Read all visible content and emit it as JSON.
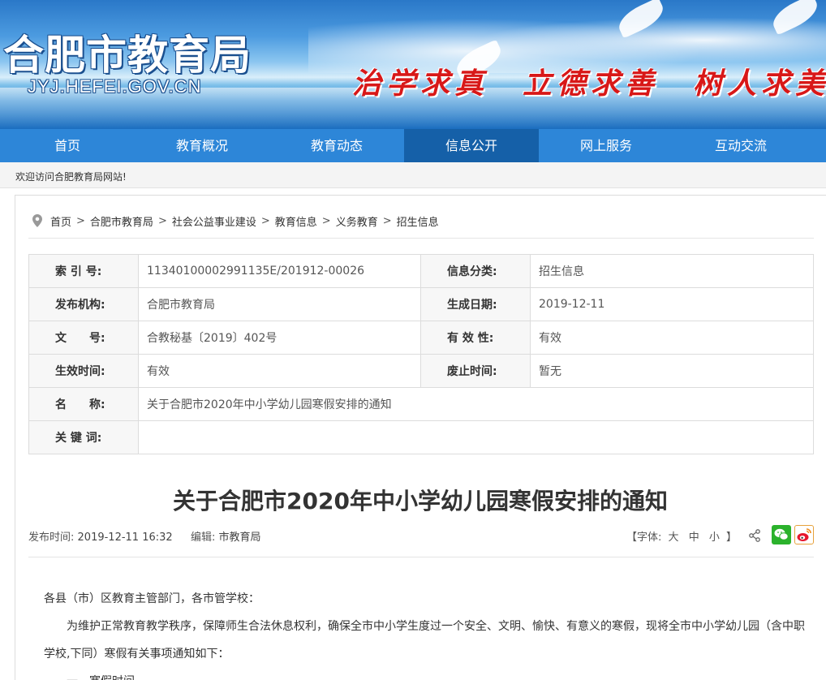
{
  "header": {
    "site_title": "合肥市教育局",
    "site_domain": "JYJ.HEFEI.GOV.CN",
    "slogan": "治学求真　立德求善　树人求美"
  },
  "nav": {
    "items": [
      {
        "label": "首页"
      },
      {
        "label": "教育概况"
      },
      {
        "label": "教育动态"
      },
      {
        "label": "信息公开"
      },
      {
        "label": "网上服务"
      },
      {
        "label": "互动交流"
      }
    ],
    "active": "信息公开"
  },
  "welcome": "欢迎访问合肥教育局网站!",
  "breadcrumb": [
    "首页",
    "合肥市教育局",
    "社会公益事业建设",
    "教育信息",
    "义务教育",
    "招生信息"
  ],
  "breadcrumb_sep": ">",
  "info": {
    "index_label": "索 引 号:",
    "index_value": "11340100002991135E/201912-00026",
    "category_label": "信息分类:",
    "category_value": "招生信息",
    "publisher_label": "发布机构:",
    "publisher_value": "合肥市教育局",
    "date_label": "生成日期:",
    "date_value": "2019-12-11",
    "doc_no_label": "文　　号:",
    "doc_no_value": "合教秘基〔2019〕402号",
    "validity_label": "有 效 性:",
    "validity_value": "有效",
    "effective_label": "生效时间:",
    "effective_value": "有效",
    "expiry_label": "废止时间:",
    "expiry_value": "暂无",
    "name_label": "名　　称:",
    "name_value": "关于合肥市2020年中小学幼儿园寒假安排的通知",
    "keywords_label": "关 键 词:",
    "keywords_value": ""
  },
  "article": {
    "title": "关于合肥市2020年中小学幼儿园寒假安排的通知",
    "publish_label": "发布时间:",
    "publish_time": "2019-12-11 16:32",
    "editor_label": "编辑:",
    "editor": "市教育局",
    "font_label_open": "【字体:",
    "font_large": "大",
    "font_medium": "中",
    "font_small": "小",
    "font_label_close": "】",
    "greeting": "各县（市）区教育主管部门，各市管学校：",
    "para1": "为维护正常教育教学秩序，保障师生合法休息权利，确保全市中小学生度过一个安全、文明、愉快、有意义的寒假，现将全市中小学幼儿园（含中职学校,下同）寒假有关事项通知如下：",
    "section1": "一、寒假时间"
  },
  "colors": {
    "nav_bg": "#2d86d8",
    "nav_active": "#1560a8",
    "slogan": "#d81818",
    "wechat": "#2bb22c"
  }
}
